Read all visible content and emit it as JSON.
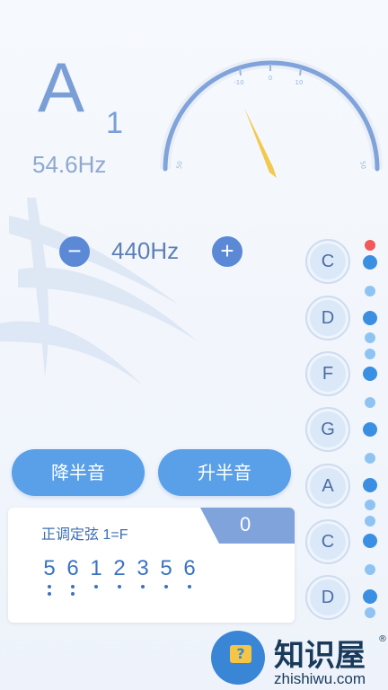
{
  "tuner": {
    "note": "A",
    "octave": "1",
    "frequency": "54.6Hz",
    "gauge_labels": {
      "minus10": "-10",
      "zero": "0",
      "plus10": "10",
      "left": "50",
      "right": "50"
    },
    "needle_cents": -12
  },
  "reference": {
    "value": "440Hz",
    "minus_icon": "minus-icon",
    "plus_icon": "plus-icon"
  },
  "actions": {
    "semitone_down": "降半音",
    "semitone_up": "升半音"
  },
  "tuning": {
    "title": "正调定弦 1=F",
    "count": "0",
    "digits": [
      "5",
      "6",
      "1",
      "2",
      "3",
      "5",
      "6"
    ]
  },
  "strings": [
    "C",
    "D",
    "F",
    "G",
    "A",
    "C",
    "D"
  ],
  "watermark": {
    "title": "知识屋",
    "reg": "®",
    "url": "zhishiwu.com",
    "icon": "question-monitor-icon"
  },
  "colors": {
    "accent": "#5aa0e8",
    "indicator": "#3b8fe3",
    "alert": "#f05a5a",
    "needle": "#f2c94c"
  }
}
